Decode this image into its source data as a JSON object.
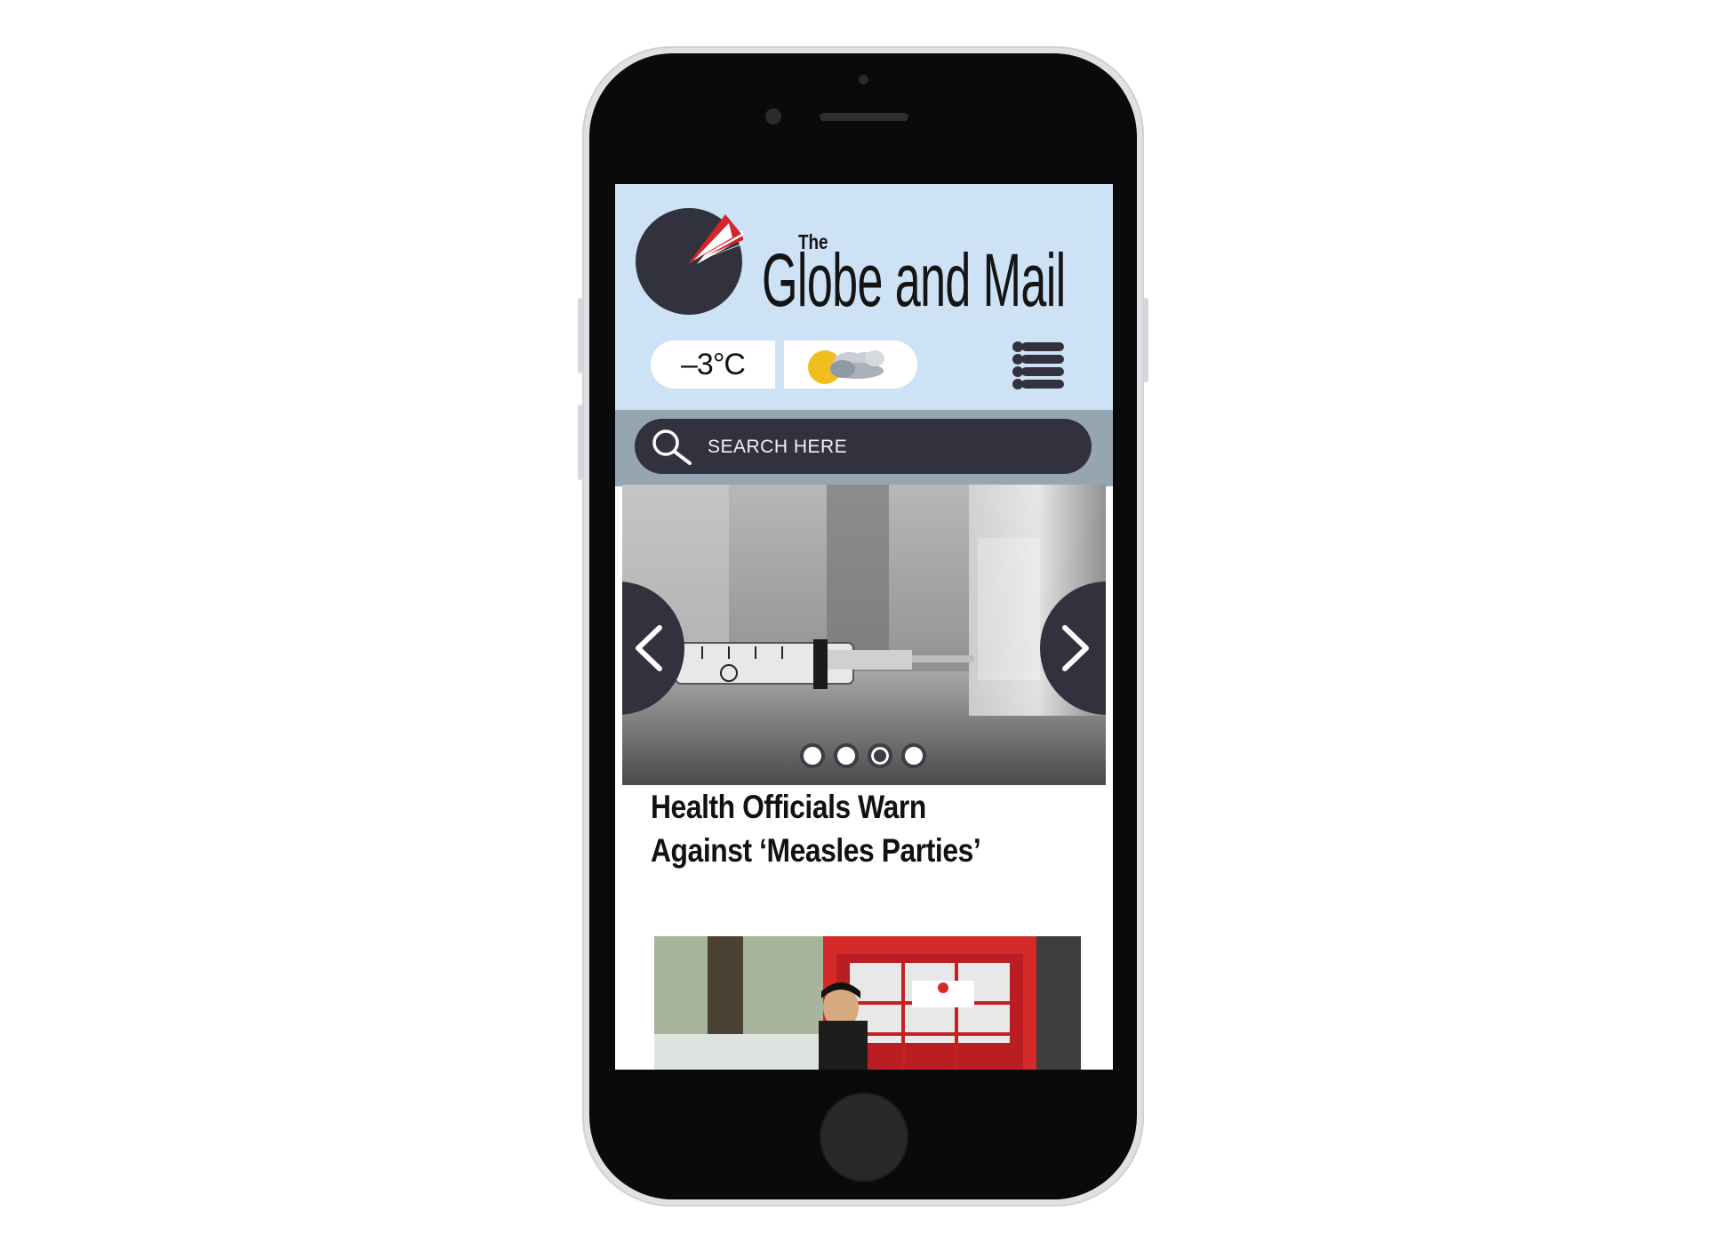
{
  "masthead": {
    "prefix": "The",
    "title": "Globe and Mail"
  },
  "weather": {
    "temperature": "–3°C",
    "condition_icon": "partly-cloudy-icon"
  },
  "menu": {
    "icon": "list-menu-icon"
  },
  "search": {
    "placeholder": "SEARCH HERE"
  },
  "carousel": {
    "slide_count": 4,
    "active_index": 2,
    "prev_icon": "chevron-left-icon",
    "next_icon": "chevron-right-icon"
  },
  "article": {
    "headline": "Health Officials Warn Against ‘Measles Parties’"
  },
  "colors": {
    "header_bg": "#cde2f4",
    "search_band": "#95a6b2",
    "dark_accent": "#31323d",
    "logo_red": "#d6252a",
    "sun_yellow": "#f0bf1f"
  }
}
